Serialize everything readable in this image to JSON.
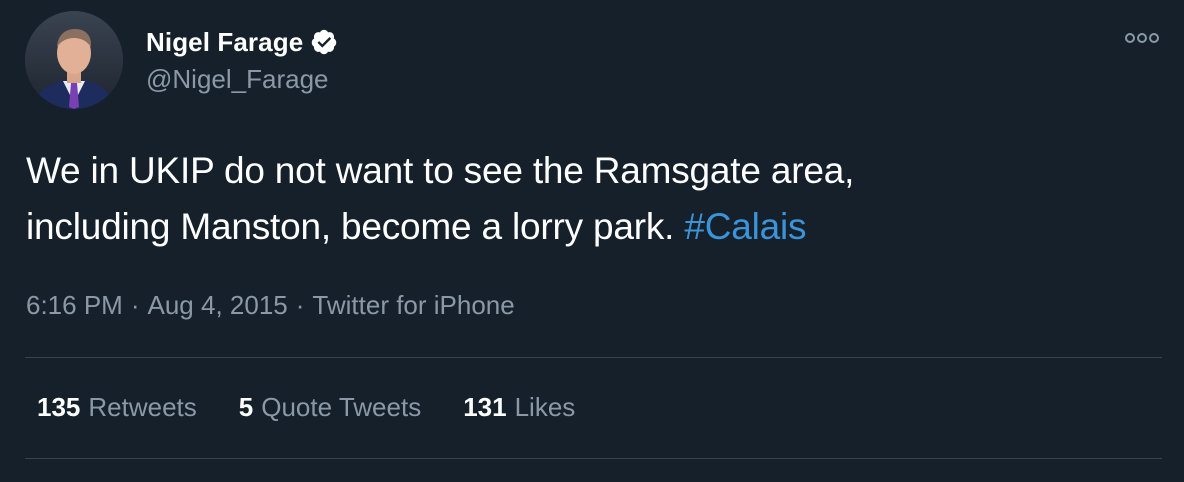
{
  "author": {
    "display_name": "Nigel Farage",
    "handle": "@Nigel_Farage",
    "verified": true
  },
  "tweet": {
    "text_line1": "We in UKIP do not want to see the Ramsgate area,",
    "text_line2": "including Manston, become a lorry park.",
    "hashtag": "#Calais",
    "time": "6:16 PM",
    "date": "Aug 4, 2015",
    "source": "Twitter for iPhone",
    "separator": "·"
  },
  "stats": {
    "retweets_count": "135",
    "retweets_label": "Retweets",
    "quotes_count": "5",
    "quotes_label": "Quote Tweets",
    "likes_count": "131",
    "likes_label": "Likes"
  },
  "icons": {
    "verified": "verified-badge-icon",
    "more": "more-options-icon"
  },
  "colors": {
    "background": "#15202b",
    "text": "#ffffff",
    "secondary": "#8b98a5",
    "link": "#3b94d9",
    "divider": "#38444d"
  }
}
